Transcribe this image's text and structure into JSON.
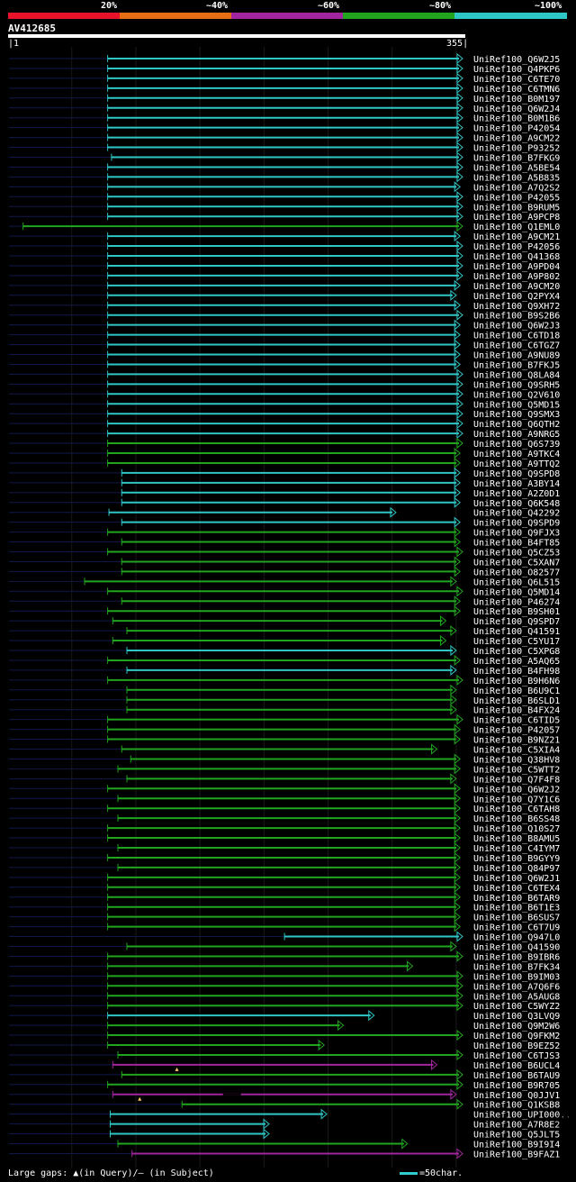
{
  "legend": {
    "labels": [
      "20%",
      "~40%",
      "~60%",
      "~80%",
      "~100%"
    ],
    "colors": [
      "#e8132b",
      "#e86e16",
      "#a1259e",
      "#21a51f",
      "#2fc6c6"
    ]
  },
  "query": {
    "id": "AV412685",
    "start": "1",
    "end": "355"
  },
  "footer": {
    "text": "Large gaps: ▲(in Query)/– (in Subject)",
    "scale_text": "=50char."
  },
  "chart_data": {
    "type": "alignment",
    "query_length": 355,
    "identity_bins": [
      "20%",
      "~40%",
      "~60%",
      "~80%",
      "~100%"
    ],
    "hits": [
      {
        "name": "UniRef100_Q6W2J5",
        "start": 78,
        "end": 355,
        "color": "cyan"
      },
      {
        "name": "UniRef100_Q4PKP6",
        "start": 78,
        "end": 355,
        "color": "cyan"
      },
      {
        "name": "UniRef100_C6TE70",
        "start": 78,
        "end": 355,
        "color": "cyan"
      },
      {
        "name": "UniRef100_C6TMN6",
        "start": 78,
        "end": 355,
        "color": "cyan"
      },
      {
        "name": "UniRef100_B0M197",
        "start": 78,
        "end": 355,
        "color": "cyan"
      },
      {
        "name": "UniRef100_Q6W2J4",
        "start": 78,
        "end": 355,
        "color": "cyan"
      },
      {
        "name": "UniRef100_B0M1B6",
        "start": 78,
        "end": 355,
        "color": "cyan"
      },
      {
        "name": "UniRef100_P42054",
        "start": 78,
        "end": 355,
        "color": "cyan"
      },
      {
        "name": "UniRef100_A9CM22",
        "start": 78,
        "end": 355,
        "color": "cyan"
      },
      {
        "name": "UniRef100_P93252",
        "start": 78,
        "end": 355,
        "color": "cyan"
      },
      {
        "name": "UniRef100_B7FKG9",
        "start": 81,
        "end": 355,
        "color": "cyan"
      },
      {
        "name": "UniRef100_A5BE54",
        "start": 78,
        "end": 355,
        "color": "cyan"
      },
      {
        "name": "UniRef100_A5B835",
        "start": 78,
        "end": 355,
        "color": "cyan"
      },
      {
        "name": "UniRef100_A7Q2S2",
        "start": 78,
        "end": 353,
        "color": "cyan"
      },
      {
        "name": "UniRef100_P42055",
        "start": 78,
        "end": 355,
        "color": "cyan"
      },
      {
        "name": "UniRef100_B9RUM5",
        "start": 78,
        "end": 355,
        "color": "cyan"
      },
      {
        "name": "UniRef100_A9PCP8",
        "start": 78,
        "end": 355,
        "color": "cyan"
      },
      {
        "name": "UniRef100_Q1EML0",
        "start": 12,
        "end": 355,
        "color": "green"
      },
      {
        "name": "UniRef100_A9CM21",
        "start": 78,
        "end": 353,
        "color": "cyan"
      },
      {
        "name": "UniRef100_P42056",
        "start": 78,
        "end": 355,
        "color": "cyan"
      },
      {
        "name": "UniRef100_Q41368",
        "start": 78,
        "end": 355,
        "color": "cyan"
      },
      {
        "name": "UniRef100_A9PD04",
        "start": 78,
        "end": 355,
        "color": "cyan"
      },
      {
        "name": "UniRef100_A9P802",
        "start": 78,
        "end": 355,
        "color": "cyan"
      },
      {
        "name": "UniRef100_A9CM20",
        "start": 78,
        "end": 353,
        "color": "cyan"
      },
      {
        "name": "UniRef100_Q2PYX4",
        "start": 78,
        "end": 350,
        "color": "cyan"
      },
      {
        "name": "UniRef100_Q9XH72",
        "start": 78,
        "end": 353,
        "color": "cyan"
      },
      {
        "name": "UniRef100_B9S2B6",
        "start": 78,
        "end": 355,
        "color": "cyan"
      },
      {
        "name": "UniRef100_Q6W2J3",
        "start": 78,
        "end": 353,
        "color": "cyan"
      },
      {
        "name": "UniRef100_C6TD18",
        "start": 78,
        "end": 353,
        "color": "cyan"
      },
      {
        "name": "UniRef100_C6TGZ7",
        "start": 78,
        "end": 353,
        "color": "cyan"
      },
      {
        "name": "UniRef100_A9NU89",
        "start": 78,
        "end": 353,
        "color": "cyan"
      },
      {
        "name": "UniRef100_B7FKJ5",
        "start": 78,
        "end": 353,
        "color": "cyan"
      },
      {
        "name": "UniRef100_Q8LA84",
        "start": 78,
        "end": 355,
        "color": "cyan"
      },
      {
        "name": "UniRef100_Q9SRH5",
        "start": 78,
        "end": 355,
        "color": "cyan"
      },
      {
        "name": "UniRef100_Q2V610",
        "start": 78,
        "end": 355,
        "color": "cyan"
      },
      {
        "name": "UniRef100_Q5MD15",
        "start": 78,
        "end": 355,
        "color": "cyan"
      },
      {
        "name": "UniRef100_Q9SMX3",
        "start": 78,
        "end": 355,
        "color": "cyan"
      },
      {
        "name": "UniRef100_Q6QTH2",
        "start": 78,
        "end": 355,
        "color": "cyan"
      },
      {
        "name": "UniRef100_A9NRG5",
        "start": 78,
        "end": 355,
        "color": "cyan"
      },
      {
        "name": "UniRef100_Q6S739",
        "start": 78,
        "end": 355,
        "color": "green"
      },
      {
        "name": "UniRef100_A9TKC4",
        "start": 78,
        "end": 353,
        "color": "green"
      },
      {
        "name": "UniRef100_A9TTQ2",
        "start": 78,
        "end": 353,
        "color": "green"
      },
      {
        "name": "UniRef100_Q9SPD8",
        "start": 89,
        "end": 353,
        "color": "cyan"
      },
      {
        "name": "UniRef100_A3BY14",
        "start": 89,
        "end": 353,
        "color": "cyan"
      },
      {
        "name": "UniRef100_A2Z0D1",
        "start": 89,
        "end": 353,
        "color": "cyan"
      },
      {
        "name": "UniRef100_Q6K548",
        "start": 89,
        "end": 353,
        "color": "cyan"
      },
      {
        "name": "UniRef100_Q42292",
        "start": 79,
        "end": 303,
        "color": "cyan"
      },
      {
        "name": "UniRef100_Q9SPD9",
        "start": 89,
        "end": 353,
        "color": "cyan"
      },
      {
        "name": "UniRef100_Q9FJX3",
        "start": 78,
        "end": 353,
        "color": "green"
      },
      {
        "name": "UniRef100_B4FT85",
        "start": 89,
        "end": 353,
        "color": "green"
      },
      {
        "name": "UniRef100_Q5CZ53",
        "start": 78,
        "end": 355,
        "color": "green"
      },
      {
        "name": "UniRef100_C5XAN7",
        "start": 89,
        "end": 353,
        "color": "green"
      },
      {
        "name": "UniRef100_O82577",
        "start": 89,
        "end": 353,
        "color": "green"
      },
      {
        "name": "UniRef100_Q6L515",
        "start": 60,
        "end": 350,
        "color": "green"
      },
      {
        "name": "UniRef100_Q5MD14",
        "start": 78,
        "end": 355,
        "color": "green"
      },
      {
        "name": "UniRef100_P46274",
        "start": 89,
        "end": 353,
        "color": "green"
      },
      {
        "name": "UniRef100_B9SH01",
        "start": 78,
        "end": 353,
        "color": "green"
      },
      {
        "name": "UniRef100_Q9SPD7",
        "start": 82,
        "end": 342,
        "color": "green"
      },
      {
        "name": "UniRef100_Q41591",
        "start": 93,
        "end": 350,
        "color": "green"
      },
      {
        "name": "UniRef100_C5YU17",
        "start": 82,
        "end": 342,
        "color": "green"
      },
      {
        "name": "UniRef100_C5XPG8",
        "start": 93,
        "end": 350,
        "color": "cyan"
      },
      {
        "name": "UniRef100_A5AQ65",
        "start": 78,
        "end": 353,
        "color": "green"
      },
      {
        "name": "UniRef100_B4FH98",
        "start": 93,
        "end": 350,
        "color": "cyan"
      },
      {
        "name": "UniRef100_B9H6N6",
        "start": 78,
        "end": 355,
        "color": "green"
      },
      {
        "name": "UniRef100_B6U9C1",
        "start": 93,
        "end": 350,
        "color": "green"
      },
      {
        "name": "UniRef100_B6SLD1",
        "start": 93,
        "end": 350,
        "color": "green"
      },
      {
        "name": "UniRef100_B4FX24",
        "start": 93,
        "end": 350,
        "color": "green"
      },
      {
        "name": "UniRef100_C6TID5",
        "start": 78,
        "end": 355,
        "color": "green"
      },
      {
        "name": "UniRef100_P42057",
        "start": 78,
        "end": 353,
        "color": "green"
      },
      {
        "name": "UniRef100_B9NZ21",
        "start": 78,
        "end": 353,
        "color": "green"
      },
      {
        "name": "UniRef100_C5XIA4",
        "start": 89,
        "end": 335,
        "color": "green"
      },
      {
        "name": "UniRef100_Q38HV8",
        "start": 96,
        "end": 353,
        "color": "green"
      },
      {
        "name": "UniRef100_C5WTT2",
        "start": 86,
        "end": 353,
        "color": "green"
      },
      {
        "name": "UniRef100_Q7F4F8",
        "start": 93,
        "end": 350,
        "color": "green"
      },
      {
        "name": "UniRef100_Q6W2J2",
        "start": 78,
        "end": 353,
        "color": "green"
      },
      {
        "name": "UniRef100_Q7Y1C6",
        "start": 86,
        "end": 353,
        "color": "green"
      },
      {
        "name": "UniRef100_C6TAH8",
        "start": 78,
        "end": 353,
        "color": "green"
      },
      {
        "name": "UniRef100_B6SS48",
        "start": 86,
        "end": 353,
        "color": "green"
      },
      {
        "name": "UniRef100_Q10S27",
        "start": 78,
        "end": 353,
        "color": "green"
      },
      {
        "name": "UniRef100_B8AMU5",
        "start": 78,
        "end": 353,
        "color": "green"
      },
      {
        "name": "UniRef100_C4IYM7",
        "start": 86,
        "end": 353,
        "color": "green"
      },
      {
        "name": "UniRef100_B9GYY9",
        "start": 78,
        "end": 353,
        "color": "green"
      },
      {
        "name": "UniRef100_Q84P97",
        "start": 86,
        "end": 353,
        "color": "green"
      },
      {
        "name": "UniRef100_Q6W2J1",
        "start": 78,
        "end": 353,
        "color": "green"
      },
      {
        "name": "UniRef100_C6TEX4",
        "start": 78,
        "end": 353,
        "color": "green"
      },
      {
        "name": "UniRef100_B6TAR9",
        "start": 78,
        "end": 353,
        "color": "green"
      },
      {
        "name": "UniRef100_B6T1E3",
        "start": 78,
        "end": 353,
        "color": "green"
      },
      {
        "name": "UniRef100_B6SUS7",
        "start": 78,
        "end": 353,
        "color": "green"
      },
      {
        "name": "UniRef100_C6T7U9",
        "start": 78,
        "end": 353,
        "color": "green"
      },
      {
        "name": "UniRef100_Q947L0",
        "start": 216,
        "end": 355,
        "color": "cyan"
      },
      {
        "name": "UniRef100_Q41590",
        "start": 93,
        "end": 350,
        "color": "green"
      },
      {
        "name": "UniRef100_B9IBR6",
        "start": 78,
        "end": 355,
        "color": "green"
      },
      {
        "name": "UniRef100_B7FK34",
        "start": 78,
        "end": 316,
        "color": "green"
      },
      {
        "name": "UniRef100_B9IM03",
        "start": 78,
        "end": 355,
        "color": "green"
      },
      {
        "name": "UniRef100_A7Q6F6",
        "start": 78,
        "end": 355,
        "color": "green"
      },
      {
        "name": "UniRef100_A5AUG8",
        "start": 78,
        "end": 355,
        "color": "green"
      },
      {
        "name": "UniRef100_C5WYZ2",
        "start": 78,
        "end": 355,
        "color": "green"
      },
      {
        "name": "UniRef100_Q3LVQ9",
        "start": 78,
        "end": 286,
        "color": "cyan"
      },
      {
        "name": "UniRef100_Q9M2W6",
        "start": 78,
        "end": 262,
        "color": "green"
      },
      {
        "name": "UniRef100_Q9FKM2",
        "start": 78,
        "end": 355,
        "color": "green"
      },
      {
        "name": "UniRef100_B9EZ52",
        "start": 78,
        "end": 247,
        "color": "green"
      },
      {
        "name": "UniRef100_C6TJS3",
        "start": 86,
        "end": 355,
        "color": "green"
      },
      {
        "name": "UniRef100_B6UCL4",
        "start": 82,
        "end": 335,
        "color": "purple",
        "query_gap": 132
      },
      {
        "name": "UniRef100_B6TAU9",
        "start": 89,
        "end": 355,
        "color": "green"
      },
      {
        "name": "UniRef100_B9R705",
        "start": 78,
        "end": 355,
        "color": "green"
      },
      {
        "name": "UniRef100_Q0JJV1",
        "start": 82,
        "end": 350,
        "color": "purple",
        "query_gap": 103,
        "subject_gap": [
          168,
          182
        ]
      },
      {
        "name": "UniRef100_Q1KSB8",
        "start": 136,
        "end": 355,
        "color": "green"
      },
      {
        "name": "UniRef100_UPI000..",
        "start": 80,
        "end": 249,
        "color": "cyan"
      },
      {
        "name": "UniRef100_A7R8E2",
        "start": 80,
        "end": 204,
        "color": "cyan"
      },
      {
        "name": "UniRef100_Q5JLT5",
        "start": 80,
        "end": 204,
        "color": "cyan"
      },
      {
        "name": "UniRef100_B9I9I4",
        "start": 86,
        "end": 312,
        "color": "green"
      },
      {
        "name": "UniRef100_B9FAZ1",
        "start": 97,
        "end": 355,
        "color": "purple"
      }
    ]
  }
}
